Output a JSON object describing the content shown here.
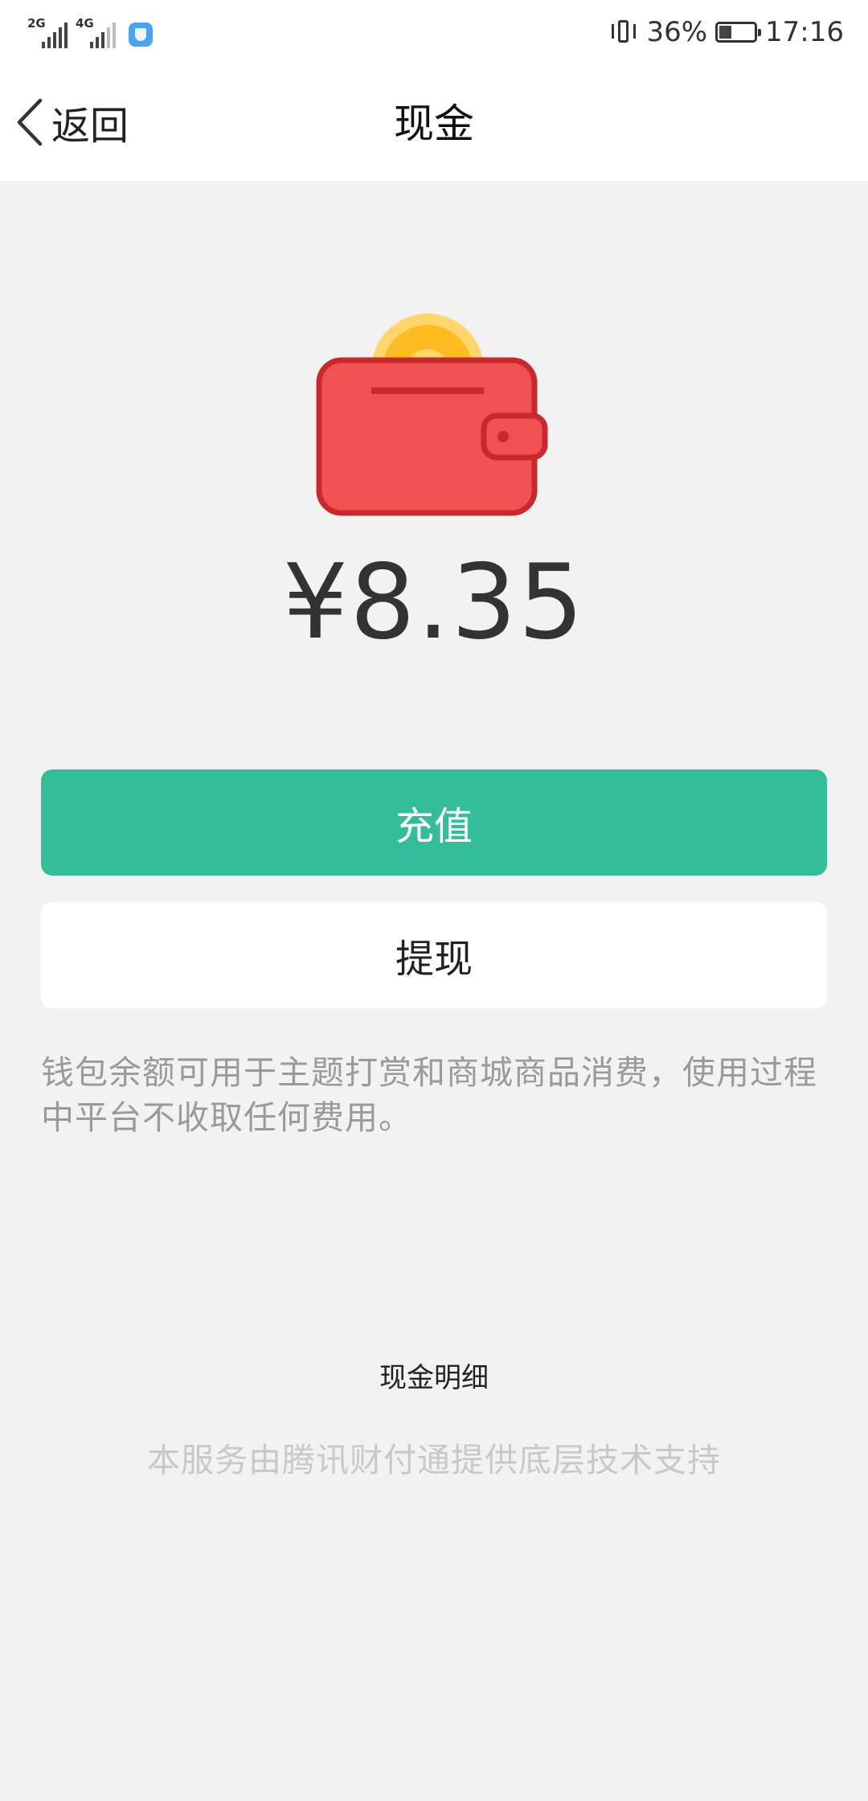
{
  "status_bar": {
    "net1_type": "2G",
    "net2_type": "4G",
    "battery_percent": "36%",
    "battery_level": 0.36,
    "time": "17:16",
    "icons": [
      "signal-icon",
      "signal-icon",
      "security-shield-icon",
      "vibrate-icon",
      "battery-icon"
    ]
  },
  "nav": {
    "back_label": "返回",
    "title": "现金"
  },
  "wallet": {
    "icon": "wallet-coin-icon",
    "colors": {
      "wallet_body": "#f05252",
      "wallet_border": "#c8282e",
      "coin_outer": "#ffd66b",
      "coin_inner": "#ffbb22"
    },
    "balance": "¥8.35"
  },
  "actions": {
    "recharge_label": "充值",
    "withdraw_label": "提现",
    "accent": "#33bd9b"
  },
  "description": "钱包余额可用于主题打赏和商城商品消费，使用过程中平台不收取任何费用。",
  "details_link": "现金明细",
  "footer_note": "本服务由腾讯财付通提供底层技术支持"
}
